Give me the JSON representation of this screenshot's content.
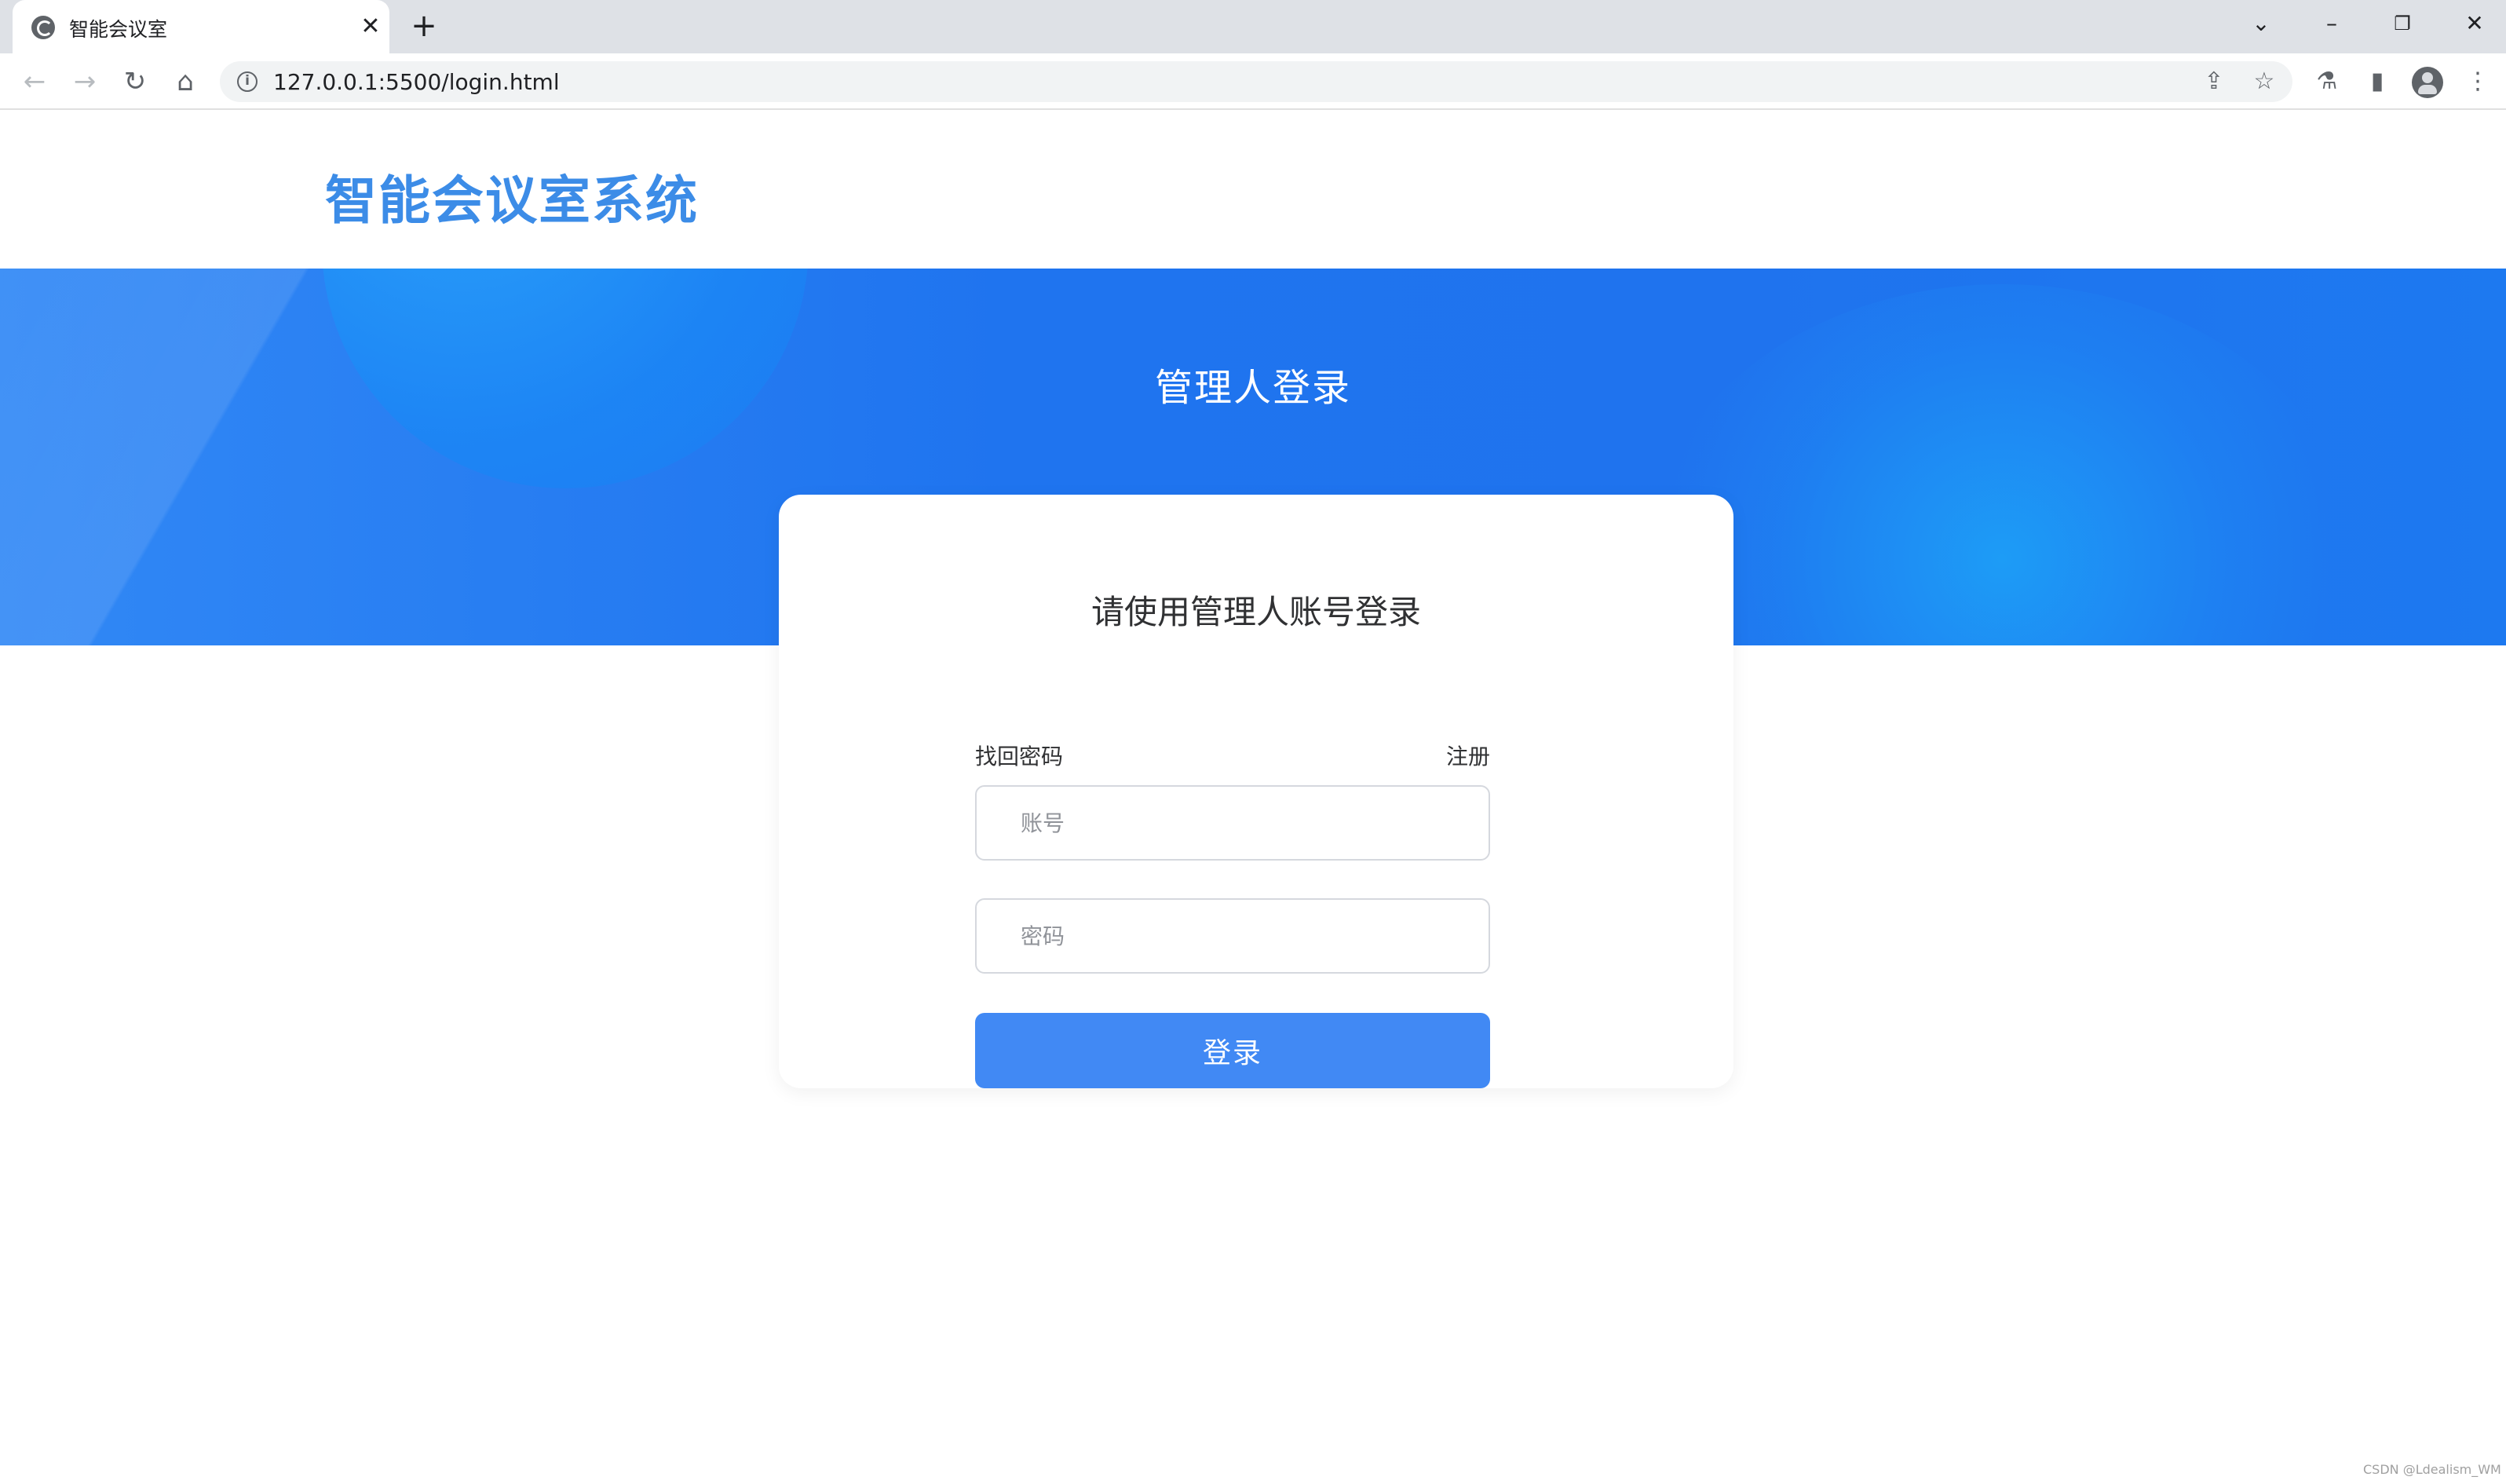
{
  "browser": {
    "tab_title": "智能会议室",
    "tab_close_glyph": "✕",
    "new_tab_glyph": "+",
    "url": "127.0.0.1:5500/login.html",
    "window_controls": {
      "dropdown": "⌄",
      "minimize": "–",
      "restore": "❐",
      "close": "✕"
    },
    "nav": {
      "back": "←",
      "forward": "→",
      "reload": "↻",
      "home": "⌂"
    },
    "omnibox_icons": {
      "info": "i",
      "share": "⇪",
      "star": "☆"
    },
    "toolbar_icons": {
      "labs": "⚗",
      "sidebar": "▮",
      "menu": "⋮"
    }
  },
  "page": {
    "site_title": "智能会议室系统",
    "banner_title": "管理人登录",
    "card": {
      "title": "请使用管理人账号登录",
      "account_placeholder": "账号",
      "password_placeholder": "密码",
      "login_label": "登录",
      "forgot_label": "找回密码",
      "register_label": "注册"
    },
    "watermark": "CSDN @Ldealism_WM"
  },
  "colors": {
    "accent": "#3c8ce7",
    "banner": "#1f74ef",
    "button": "#4189f4"
  }
}
